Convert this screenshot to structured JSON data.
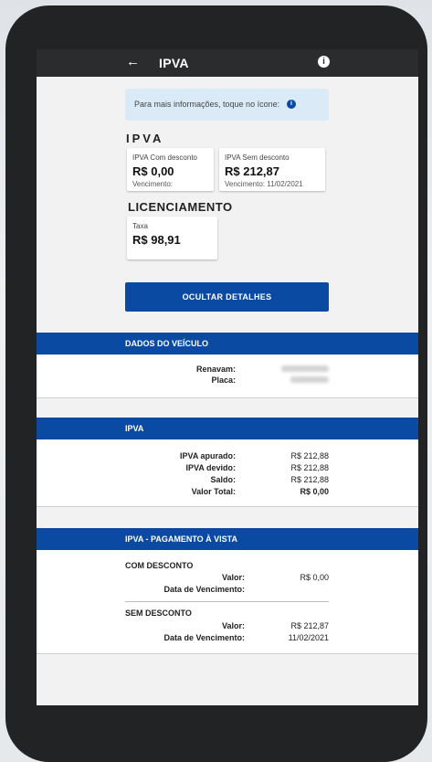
{
  "app_bar": {
    "back_icon": "arrow-left-icon",
    "title": "IPVA",
    "info_icon": "info-icon"
  },
  "info_banner": {
    "text": "Para mais informações, toque no ícone:",
    "icon": "info-icon"
  },
  "ipva_section": {
    "title": "IPVA",
    "com_desconto": {
      "label": "IPVA Com desconto",
      "amount": "R$ 0,00",
      "vencimento": "Vencimento:"
    },
    "sem_desconto": {
      "label": "IPVA Sem desconto",
      "amount": "R$ 212,87",
      "vencimento": "Vencimento: 11/02/2021"
    }
  },
  "licenciamento_section": {
    "title": "LICENCIAMENTO",
    "taxa": {
      "label": "Taxa",
      "amount": "R$ 98,91"
    }
  },
  "details_button": {
    "label": "OCULTAR DETALHES"
  },
  "dados_veiculo": {
    "header": "DADOS DO VEÍCULO",
    "renavam_label": "Renavam:",
    "placa_label": "Placa:"
  },
  "ipva_detail": {
    "header": "IPVA",
    "rows": [
      {
        "label": "IPVA apurado:",
        "value": "R$ 212,88"
      },
      {
        "label": "IPVA devido:",
        "value": "R$ 212,88"
      },
      {
        "label": "Saldo:",
        "value": "R$ 212,88"
      },
      {
        "label": "Valor Total:",
        "value": "R$ 0,00"
      }
    ]
  },
  "pagamento": {
    "header": "IPVA - PAGAMENTO À VISTA",
    "com_desconto": {
      "title": "COM DESCONTO",
      "valor_label": "Valor:",
      "valor": "R$ 0,00",
      "data_label": "Data de Vencimento:",
      "data": ""
    },
    "sem_desconto": {
      "title": "SEM DESCONTO",
      "valor_label": "Valor:",
      "valor": "R$ 212,87",
      "data_label": "Data de Vencimento:",
      "data": "11/02/2021"
    }
  },
  "colors": {
    "primary_blue": "#0b4aa2",
    "app_bar": "#2b2c2e",
    "info_banner_bg": "#dbeaf7",
    "device_frame": "#222325"
  }
}
